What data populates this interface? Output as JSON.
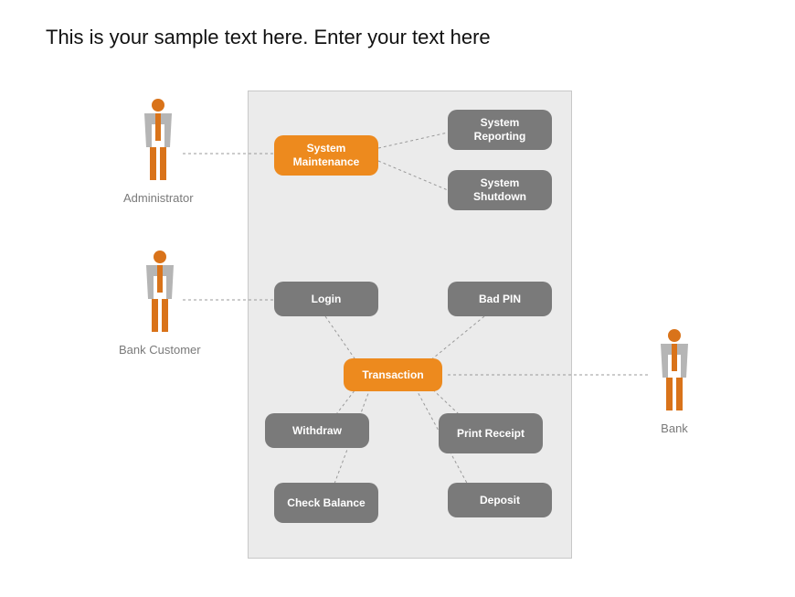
{
  "title": "This is your sample text here. Enter your text here",
  "actors": {
    "administrator": {
      "label": "Administrator"
    },
    "bank_customer": {
      "label": "Bank Customer"
    },
    "bank": {
      "label": "Bank"
    }
  },
  "nodes": {
    "system_maintenance": "System Maintenance",
    "system_reporting": "System Reporting",
    "system_shutdown": "System Shutdown",
    "login": "Login",
    "bad_pin": "Bad PIN",
    "transaction": "Transaction",
    "withdraw": "Withdraw",
    "print_receipt": "Print Receipt",
    "check_balance": "Check Balance",
    "deposit": "Deposit"
  },
  "colors": {
    "accent": "#ed8a1e",
    "node_gray": "#7a7a7a",
    "label_gray": "#7a7a7a",
    "box_bg": "#ebebeb"
  }
}
